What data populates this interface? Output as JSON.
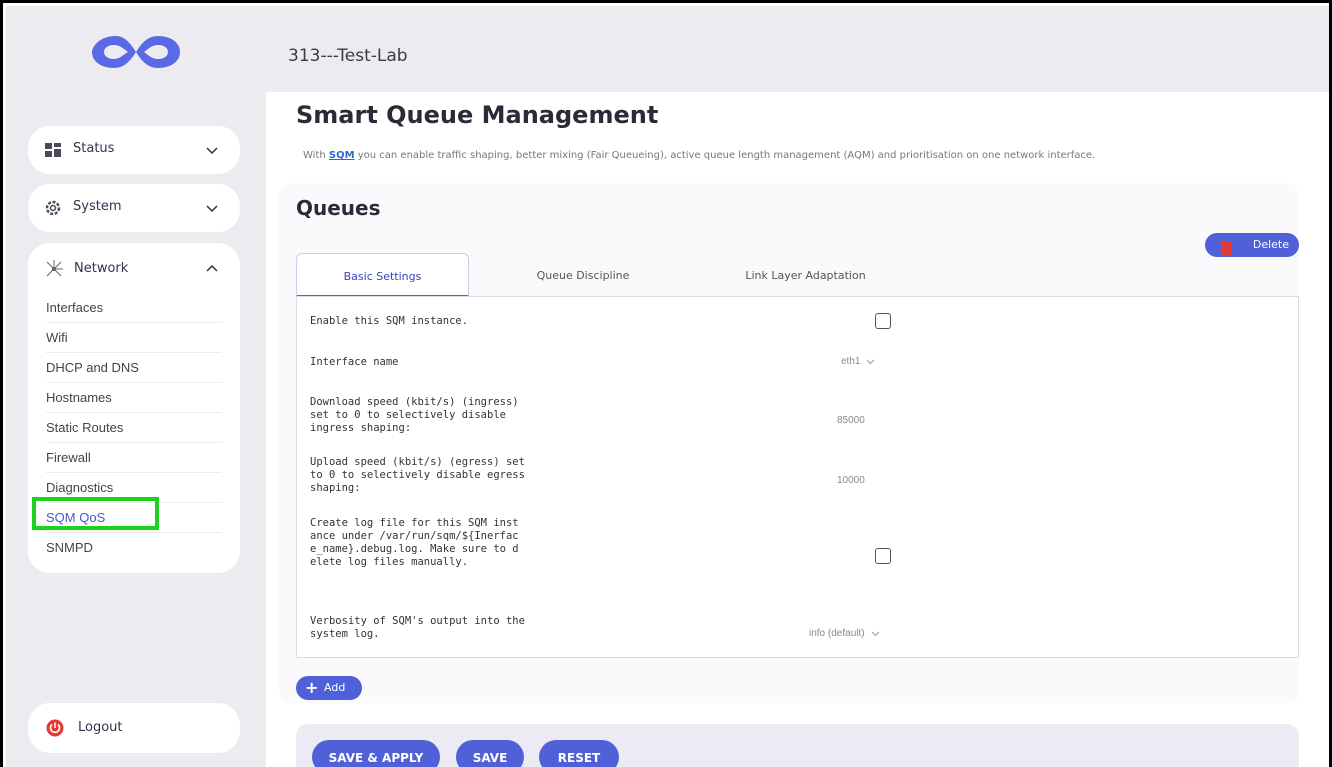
{
  "header": {
    "title": "313---Test-Lab"
  },
  "sidebar": {
    "status_label": "Status",
    "system_label": "System",
    "network_label": "Network",
    "network_items": [
      "Interfaces",
      "Wifi",
      "DHCP and DNS",
      "Hostnames",
      "Static Routes",
      "Firewall",
      "Diagnostics",
      "SQM QoS",
      "SNMPD"
    ],
    "active_item": "SQM QoS",
    "logout_label": "Logout"
  },
  "page": {
    "title": "Smart Queue Management",
    "desc_prefix": "With ",
    "desc_link": "SQM",
    "desc_rest": " you can enable traffic shaping, better mixing (Fair Queueing), active queue length management (AQM) and prioritisation on one network interface."
  },
  "queues": {
    "title": "Queues",
    "delete_label": "Delete",
    "tabs": [
      "Basic Settings",
      "Queue Discipline",
      "Link Layer Adaptation"
    ],
    "active_tab": "Basic Settings",
    "fields": {
      "enable": "Enable this SQM instance.",
      "interface_label": "Interface name",
      "interface_value": "eth1",
      "download_label": "Download speed (kbit/s) (ingress) set to 0 to selectively disable ingress shaping:",
      "download_value": "85000",
      "upload_label": "Upload speed (kbit/s) (egress) set to 0 to selectively disable egress shaping:",
      "upload_value": "10000",
      "log_label": "Create log file for this SQM instance under /var/run/sqm/${Inerface_name}.debug.log. Make sure to delete log files manually.",
      "verbosity_label": "Verbosity of SQM's output into the system log.",
      "verbosity_value": "info (default)"
    },
    "add_label": "Add"
  },
  "actions": {
    "save_apply": "SAVE & APPLY",
    "save": "SAVE",
    "reset": "RESET"
  },
  "colors": {
    "accent": "#5060d8",
    "highlight_box": "#1fd11f",
    "logout_icon": "#e53935"
  }
}
